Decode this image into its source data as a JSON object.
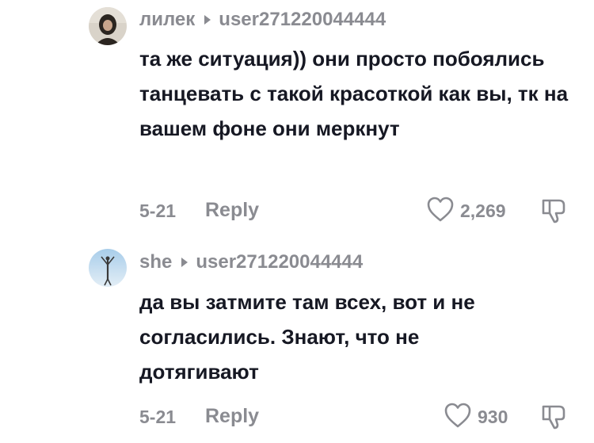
{
  "comments": [
    {
      "username": "лилек",
      "reply_to": "user271220044444",
      "text": "та же ситуация)) они просто побоялись танцевать с такой красоткой как вы, тк на вашем фоне они меркнут",
      "date": "5-21",
      "reply_label": "Reply",
      "likes": "2,269",
      "avatar_colors": [
        "#d8d2c8",
        "#2a2622"
      ]
    },
    {
      "username": "she",
      "reply_to": "user271220044444",
      "text": "да вы затмите там всех, вот и не согласились. Знают, что не дотягивают",
      "date": "5-21",
      "reply_label": "Reply",
      "likes": "930",
      "avatar_colors": [
        "#b8d6ec",
        "#3a3a3a"
      ]
    }
  ],
  "icons": {
    "reply_arrow": "caret-right-icon",
    "like": "heart-icon",
    "dislike": "thumbs-down-icon"
  },
  "colors": {
    "text_primary": "#161823",
    "text_secondary": "#8a8b91"
  }
}
